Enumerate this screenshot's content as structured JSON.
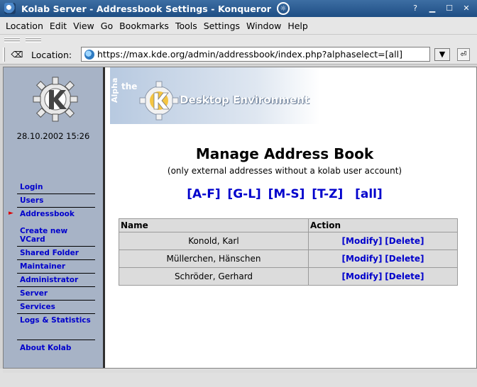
{
  "window": {
    "title": "Kolab Server - Addressbook Settings - Konqueror",
    "controls": [
      "help",
      "minimize",
      "maximize",
      "close"
    ]
  },
  "menu": [
    "Location",
    "Edit",
    "View",
    "Go",
    "Bookmarks",
    "Tools",
    "Settings",
    "Window",
    "Help"
  ],
  "locationbar": {
    "label": "Location:",
    "url": "https://max.kde.org/admin/addressbook/index.php?alphaselect=[all]"
  },
  "sidebar": {
    "datetime": "28.10.2002 15:26",
    "nav": [
      "Login",
      "Users",
      "Addressbook",
      "Create new VCard",
      "Shared Folder",
      "Maintainer",
      "Administrator",
      "Server",
      "Services",
      "Logs & Statistics",
      "About Kolab"
    ],
    "active": "Addressbook"
  },
  "banner": {
    "vertical": "Alpha",
    "the": "the",
    "text": "Desktop Environment"
  },
  "page": {
    "heading": "Manage Address Book",
    "subheading": "(only external addresses without a kolab user account)",
    "alpha_filters": [
      "[A-F]",
      "[G-L]",
      "[M-S]",
      "[T-Z]",
      "[all]"
    ]
  },
  "table": {
    "headers": [
      "Name",
      "Action"
    ],
    "rows": [
      {
        "name": "Konold, Karl",
        "modify": "[Modify]",
        "delete": "[Delete]"
      },
      {
        "name": "Müllerchen, Hänschen",
        "modify": "[Modify]",
        "delete": "[Delete]"
      },
      {
        "name": "Schröder, Gerhard",
        "modify": "[Modify]",
        "delete": "[Delete]"
      }
    ]
  },
  "colors": {
    "sidebar_bg": "#a7b3c6",
    "link": "#0000cc",
    "titlebar": "#2a5d94"
  }
}
